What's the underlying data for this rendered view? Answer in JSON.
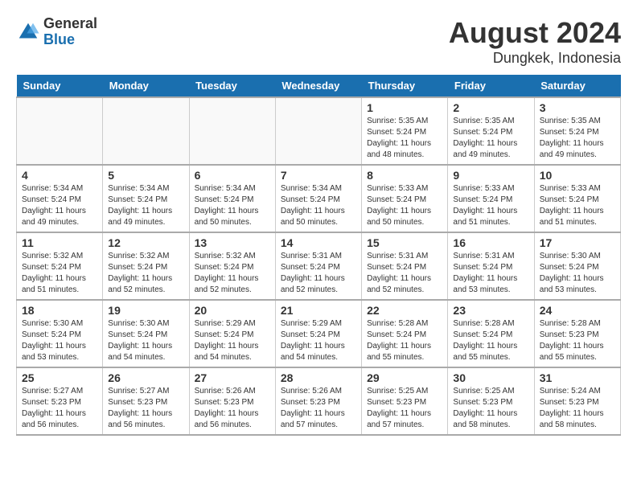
{
  "header": {
    "logo": {
      "general": "General",
      "blue": "Blue"
    },
    "title": "August 2024",
    "subtitle": "Dungkek, Indonesia"
  },
  "calendar": {
    "days_of_week": [
      "Sunday",
      "Monday",
      "Tuesday",
      "Wednesday",
      "Thursday",
      "Friday",
      "Saturday"
    ],
    "weeks": [
      [
        {
          "day": "",
          "info": ""
        },
        {
          "day": "",
          "info": ""
        },
        {
          "day": "",
          "info": ""
        },
        {
          "day": "",
          "info": ""
        },
        {
          "day": "1",
          "info": "Sunrise: 5:35 AM\nSunset: 5:24 PM\nDaylight: 11 hours\nand 48 minutes."
        },
        {
          "day": "2",
          "info": "Sunrise: 5:35 AM\nSunset: 5:24 PM\nDaylight: 11 hours\nand 49 minutes."
        },
        {
          "day": "3",
          "info": "Sunrise: 5:35 AM\nSunset: 5:24 PM\nDaylight: 11 hours\nand 49 minutes."
        }
      ],
      [
        {
          "day": "4",
          "info": "Sunrise: 5:34 AM\nSunset: 5:24 PM\nDaylight: 11 hours\nand 49 minutes."
        },
        {
          "day": "5",
          "info": "Sunrise: 5:34 AM\nSunset: 5:24 PM\nDaylight: 11 hours\nand 49 minutes."
        },
        {
          "day": "6",
          "info": "Sunrise: 5:34 AM\nSunset: 5:24 PM\nDaylight: 11 hours\nand 50 minutes."
        },
        {
          "day": "7",
          "info": "Sunrise: 5:34 AM\nSunset: 5:24 PM\nDaylight: 11 hours\nand 50 minutes."
        },
        {
          "day": "8",
          "info": "Sunrise: 5:33 AM\nSunset: 5:24 PM\nDaylight: 11 hours\nand 50 minutes."
        },
        {
          "day": "9",
          "info": "Sunrise: 5:33 AM\nSunset: 5:24 PM\nDaylight: 11 hours\nand 51 minutes."
        },
        {
          "day": "10",
          "info": "Sunrise: 5:33 AM\nSunset: 5:24 PM\nDaylight: 11 hours\nand 51 minutes."
        }
      ],
      [
        {
          "day": "11",
          "info": "Sunrise: 5:32 AM\nSunset: 5:24 PM\nDaylight: 11 hours\nand 51 minutes."
        },
        {
          "day": "12",
          "info": "Sunrise: 5:32 AM\nSunset: 5:24 PM\nDaylight: 11 hours\nand 52 minutes."
        },
        {
          "day": "13",
          "info": "Sunrise: 5:32 AM\nSunset: 5:24 PM\nDaylight: 11 hours\nand 52 minutes."
        },
        {
          "day": "14",
          "info": "Sunrise: 5:31 AM\nSunset: 5:24 PM\nDaylight: 11 hours\nand 52 minutes."
        },
        {
          "day": "15",
          "info": "Sunrise: 5:31 AM\nSunset: 5:24 PM\nDaylight: 11 hours\nand 52 minutes."
        },
        {
          "day": "16",
          "info": "Sunrise: 5:31 AM\nSunset: 5:24 PM\nDaylight: 11 hours\nand 53 minutes."
        },
        {
          "day": "17",
          "info": "Sunrise: 5:30 AM\nSunset: 5:24 PM\nDaylight: 11 hours\nand 53 minutes."
        }
      ],
      [
        {
          "day": "18",
          "info": "Sunrise: 5:30 AM\nSunset: 5:24 PM\nDaylight: 11 hours\nand 53 minutes."
        },
        {
          "day": "19",
          "info": "Sunrise: 5:30 AM\nSunset: 5:24 PM\nDaylight: 11 hours\nand 54 minutes."
        },
        {
          "day": "20",
          "info": "Sunrise: 5:29 AM\nSunset: 5:24 PM\nDaylight: 11 hours\nand 54 minutes."
        },
        {
          "day": "21",
          "info": "Sunrise: 5:29 AM\nSunset: 5:24 PM\nDaylight: 11 hours\nand 54 minutes."
        },
        {
          "day": "22",
          "info": "Sunrise: 5:28 AM\nSunset: 5:24 PM\nDaylight: 11 hours\nand 55 minutes."
        },
        {
          "day": "23",
          "info": "Sunrise: 5:28 AM\nSunset: 5:24 PM\nDaylight: 11 hours\nand 55 minutes."
        },
        {
          "day": "24",
          "info": "Sunrise: 5:28 AM\nSunset: 5:23 PM\nDaylight: 11 hours\nand 55 minutes."
        }
      ],
      [
        {
          "day": "25",
          "info": "Sunrise: 5:27 AM\nSunset: 5:23 PM\nDaylight: 11 hours\nand 56 minutes."
        },
        {
          "day": "26",
          "info": "Sunrise: 5:27 AM\nSunset: 5:23 PM\nDaylight: 11 hours\nand 56 minutes."
        },
        {
          "day": "27",
          "info": "Sunrise: 5:26 AM\nSunset: 5:23 PM\nDaylight: 11 hours\nand 56 minutes."
        },
        {
          "day": "28",
          "info": "Sunrise: 5:26 AM\nSunset: 5:23 PM\nDaylight: 11 hours\nand 57 minutes."
        },
        {
          "day": "29",
          "info": "Sunrise: 5:25 AM\nSunset: 5:23 PM\nDaylight: 11 hours\nand 57 minutes."
        },
        {
          "day": "30",
          "info": "Sunrise: 5:25 AM\nSunset: 5:23 PM\nDaylight: 11 hours\nand 58 minutes."
        },
        {
          "day": "31",
          "info": "Sunrise: 5:24 AM\nSunset: 5:23 PM\nDaylight: 11 hours\nand 58 minutes."
        }
      ]
    ]
  }
}
